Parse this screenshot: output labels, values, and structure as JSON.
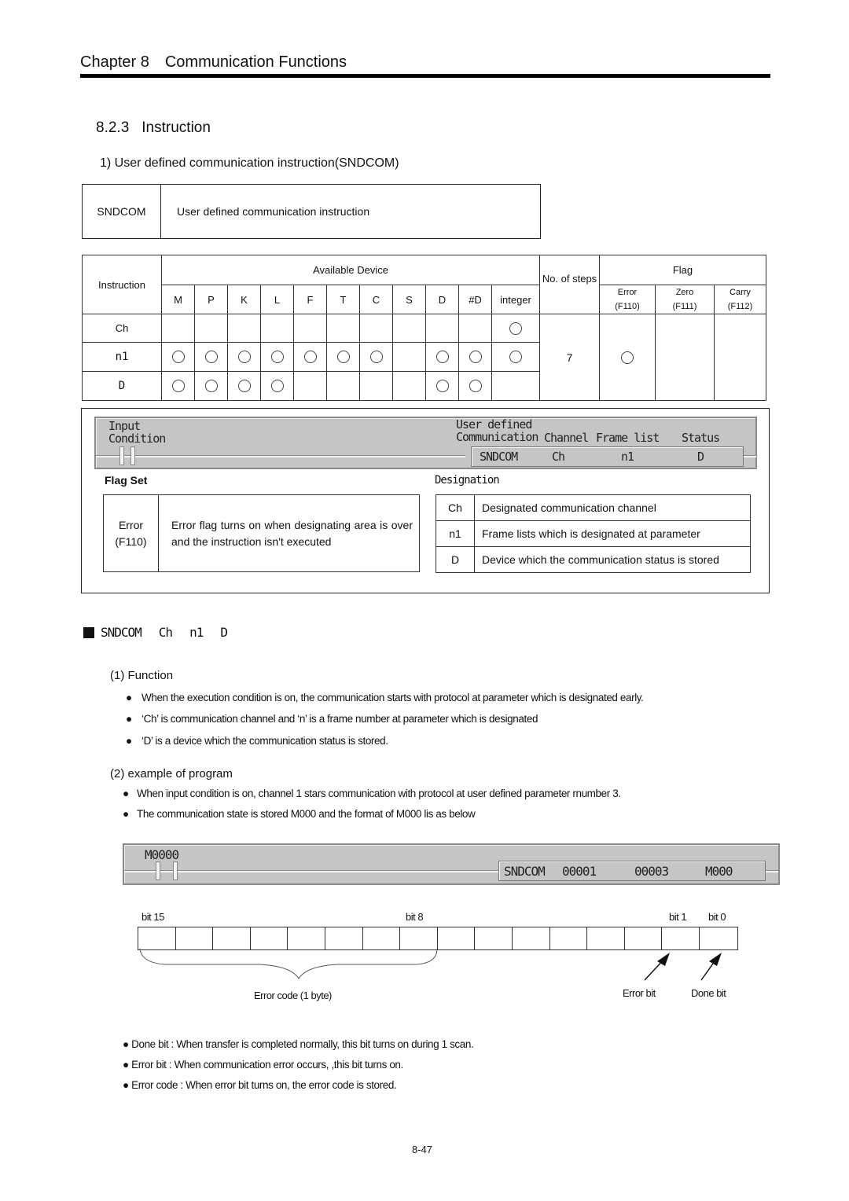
{
  "header": {
    "chapter_num": "Chapter 8",
    "chapter_title": "Communication Functions"
  },
  "section": {
    "number": "8.2.3",
    "title": "Instruction"
  },
  "subsection": "1) User defined communication instruction(SNDCOM)",
  "name_box": {
    "mnemonic": "SNDCOM",
    "description": "User defined communication instruction"
  },
  "device_table": {
    "instruction_header": "Instruction",
    "available_header": "Available Device",
    "devices": [
      "M",
      "P",
      "K",
      "L",
      "F",
      "T",
      "C",
      "S",
      "D",
      "#D",
      "integer"
    ],
    "steps_header": "No. of steps",
    "flag_header": "Flag",
    "flags": [
      {
        "name": "Error",
        "code": "(F110)"
      },
      {
        "name": "Zero",
        "code": "(F111)"
      },
      {
        "name": "Carry",
        "code": "(F112)"
      }
    ],
    "rows": [
      {
        "operand": "Ch",
        "marks": [
          false,
          false,
          false,
          false,
          false,
          false,
          false,
          false,
          false,
          false,
          true
        ]
      },
      {
        "operand": "n1",
        "marks": [
          true,
          true,
          true,
          true,
          true,
          true,
          true,
          false,
          true,
          true,
          true
        ]
      },
      {
        "operand": "D",
        "marks": [
          true,
          true,
          true,
          true,
          false,
          false,
          false,
          false,
          true,
          true,
          false
        ]
      }
    ],
    "steps": "7",
    "flag_marks": [
      true,
      false,
      false
    ]
  },
  "ladder1": {
    "input_label_1": "Input",
    "input_label_2": "Condition",
    "user_defined": "User defined",
    "communication": "Communication",
    "channel": "Channel",
    "frame_list": "Frame list",
    "status": "Status",
    "instr": "SNDCOM",
    "op1": "Ch",
    "op2": "n1",
    "op3": "D"
  },
  "flag_set": {
    "title": "Flag Set",
    "rows": [
      {
        "flag": "Error",
        "code": "(F110)",
        "desc": "Error flag turns on when designating area is over and the instruction isn't executed"
      }
    ]
  },
  "designation": {
    "title": "Designation",
    "rows": [
      {
        "op": "Ch",
        "desc": "Designated communication channel"
      },
      {
        "op": "n1",
        "desc": "Frame lists which is designated at parameter"
      },
      {
        "op": "D",
        "desc": "Device which the communication status is stored"
      }
    ]
  },
  "syntax": {
    "instr": "SNDCOM",
    "op1": "Ch",
    "op2": "n1",
    "op3": "D"
  },
  "function": {
    "title": "(1) Function",
    "bullets": [
      "When the execution condition is on, the communication starts with protocol at parameter which is designated early.",
      "‘Ch’ is communication channel and ‘n’ is a frame number at parameter which is designated",
      "‘D’ is a device which the communication status is stored."
    ]
  },
  "example": {
    "title": "(2) example of program",
    "bullets": [
      "When input condition is on, channel 1 stars communication with protocol at user defined parameter rnumber 3.",
      "The communication state is stored M000 and the format of M000 lis as below"
    ]
  },
  "ladder2": {
    "contact": "M0000",
    "instr": "SNDCOM",
    "op1": "00001",
    "op2": "00003",
    "op3": "M000"
  },
  "bit_diagram": {
    "bit15": "bit 15",
    "bit8": "bit 8",
    "bit1": "bit 1",
    "bit0": "bit 0",
    "error_code": "Error code (1 byte)",
    "error_bit": "Error bit",
    "done_bit": "Done bit"
  },
  "notes": [
    "Done bit : When transfer is completed normally, this bit turns on during 1 scan.",
    "Error bit : When communication error occurs, ,this bit turns on.",
    "Error code : When error bit turns on, the error code is stored."
  ],
  "page_number": "8-47"
}
